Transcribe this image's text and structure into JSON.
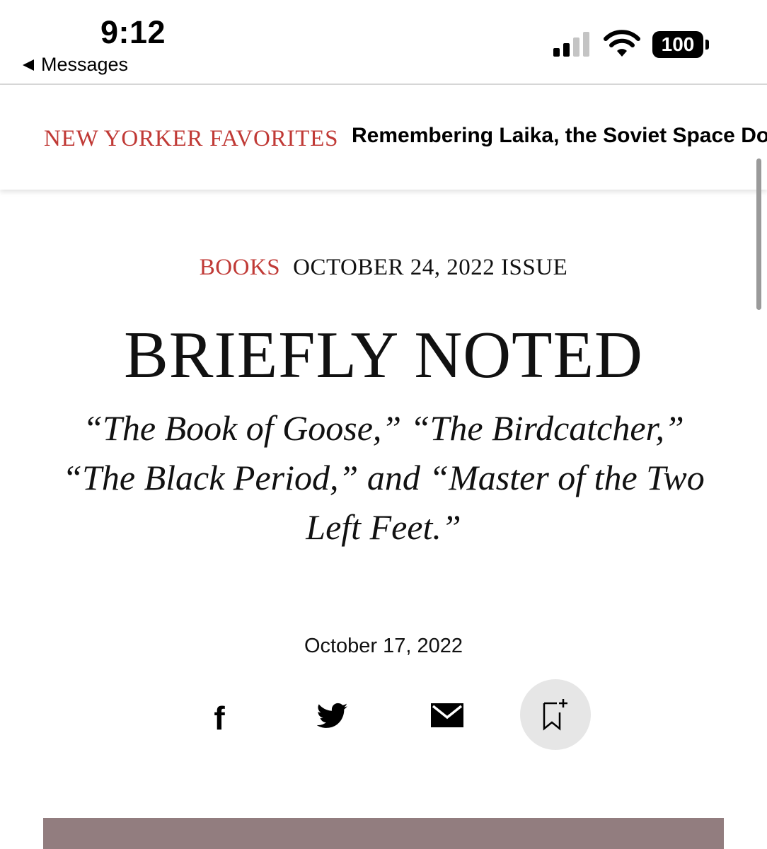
{
  "status_bar": {
    "time": "9:12",
    "back_label": "Messages",
    "battery": "100",
    "signal_icon": "cellular-signal-icon",
    "wifi_icon": "wifi-icon"
  },
  "header": {
    "favorites_label": "NEW YORKER FAVORITES",
    "featured_headline": "Remembering Laika, the Soviet Space Dog"
  },
  "article": {
    "section": "BOOKS",
    "issue": "OCTOBER 24, 2022 ISSUE",
    "title": "BRIEFLY NOTED",
    "dek": "“The Book of Goose,” “The Birdcatcher,” “The Black Period,” and “Master of the Two Left Feet.”",
    "date": "October 17, 2022"
  },
  "share": {
    "facebook_glyph": "f",
    "icons": [
      "facebook-icon",
      "twitter-icon",
      "email-icon",
      "bookmark-add-icon"
    ]
  },
  "colors": {
    "accent_red": "#c03a36",
    "save_button_bg": "#e6e6e6",
    "image_placeholder": "#927d7f"
  }
}
